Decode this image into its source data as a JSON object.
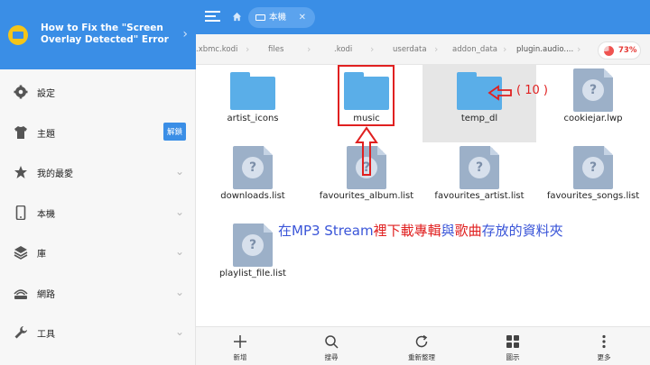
{
  "sidebar": {
    "header_title": "How to Fix the \"Screen Overlay Detected\" Error",
    "items": [
      {
        "label": "設定"
      },
      {
        "label": "主題",
        "badge": "解鎖"
      },
      {
        "label": "我的最愛"
      },
      {
        "label": "本機"
      },
      {
        "label": "庫"
      },
      {
        "label": "網路"
      },
      {
        "label": "工具"
      }
    ]
  },
  "topbar": {
    "tab_label": "本機",
    "tab_close": "✕"
  },
  "breadcrumb": {
    "items": [
      ".xbmc.kodi",
      "files",
      ".kodi",
      "userdata",
      "addon_data",
      "plugin.audio...."
    ],
    "storage_percent": "73%"
  },
  "files": [
    {
      "name": "artist_icons",
      "type": "folder"
    },
    {
      "name": "music",
      "type": "folder"
    },
    {
      "name": "temp_dl",
      "type": "folder"
    },
    {
      "name": "cookiejar.lwp",
      "type": "unknown"
    },
    {
      "name": "downloads.list",
      "type": "unknown"
    },
    {
      "name": "favourites_album.list",
      "type": "unknown"
    },
    {
      "name": "favourites_artist.list",
      "type": "unknown"
    },
    {
      "name": "favourites_songs.list",
      "type": "unknown"
    },
    {
      "name": "playlist_file.list",
      "type": "unknown"
    }
  ],
  "annotation": {
    "count_label": "( 10 )",
    "caption_blue_1": "在MP3 Stream",
    "caption_red_1": "裡下載專輯",
    "caption_blue_2": "與",
    "caption_red_2": "歌曲",
    "caption_blue_3": "存放的資料夾"
  },
  "bottombar": {
    "new": "新增",
    "search": "搜尋",
    "refresh": "重新整理",
    "view": "圖示",
    "more": "更多"
  },
  "colors": {
    "accent": "#3a8ee6",
    "folder": "#5aaee8",
    "annotation": "#e02020"
  }
}
